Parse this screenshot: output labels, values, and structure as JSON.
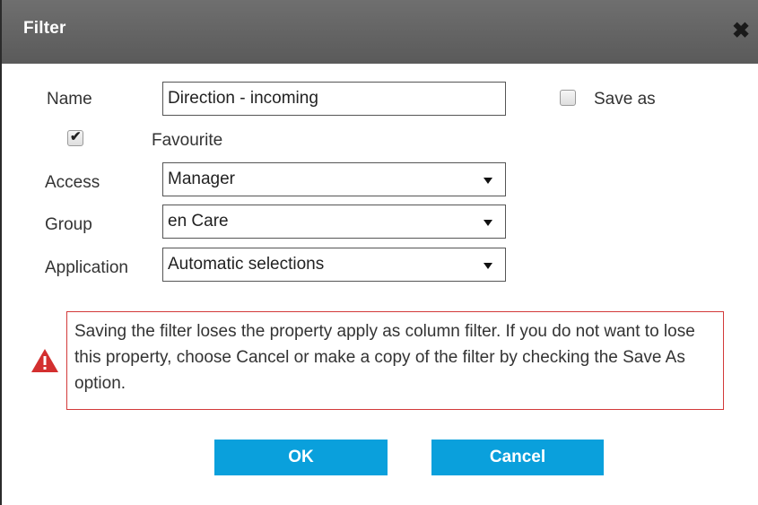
{
  "dialog": {
    "title": "Filter",
    "close_icon": "close-icon"
  },
  "form": {
    "name_label": "Name",
    "name_value": "Direction - incoming",
    "save_as_label": "Save as",
    "save_as_checked": false,
    "favourite_label": "Favourite",
    "favourite_checked": true,
    "access_label": "Access",
    "access_value": "Manager",
    "group_label": "Group",
    "group_value": "en Care",
    "application_label": "Application",
    "application_value": "Automatic selections"
  },
  "warning": {
    "icon": "warning-triangle-icon",
    "icon_color": "#d32f2f",
    "text": "Saving the filter loses the property apply as column filter. If you do not want to lose this property, choose Cancel or make a copy of the filter by checking the Save As option."
  },
  "buttons": {
    "ok_label": "OK",
    "cancel_label": "Cancel",
    "color": "#0aa0dc"
  }
}
